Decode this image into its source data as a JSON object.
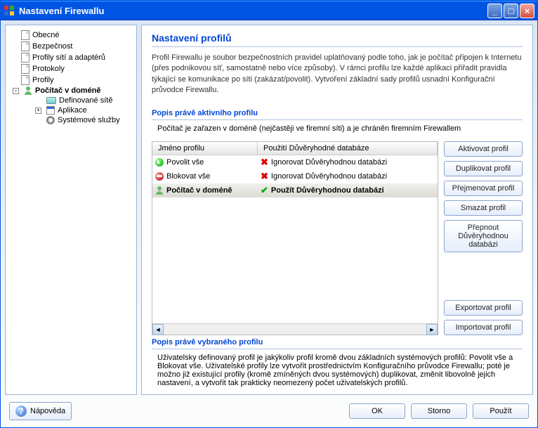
{
  "window": {
    "title": "Nastavení Firewallu"
  },
  "tree": {
    "items": [
      {
        "label": "Obecné",
        "indent": 0,
        "iconType": "page"
      },
      {
        "label": "Bezpečnost",
        "indent": 0,
        "iconType": "page"
      },
      {
        "label": "Profily sítí a adaptérů",
        "indent": 0,
        "iconType": "page"
      },
      {
        "label": "Protokoly",
        "indent": 0,
        "iconType": "page"
      },
      {
        "label": "Profily",
        "indent": 0,
        "iconType": "page"
      },
      {
        "label": "Počítač v doméně",
        "indent": 1,
        "iconType": "user",
        "bold": true,
        "expander": "-"
      },
      {
        "label": "Definované sítě",
        "indent": 2,
        "iconType": "net"
      },
      {
        "label": "Aplikace",
        "indent": 2,
        "iconType": "app",
        "expander": "+"
      },
      {
        "label": "Systémové služby",
        "indent": 2,
        "iconType": "gear"
      }
    ]
  },
  "page": {
    "title": "Nastavení profilů",
    "description": "Profil Firewallu je soubor bezpečnostních pravidel uplatňovaný podle toho, jak je počítač připojen k Internetu (přes podnikovou síť, samostatně nebo více způsoby). V rámci profilu lze každé aplikaci přiřadit pravidla týkající se komunikace po síti (zakázat/povolit). Vytvoření základní sady profilů usnadní Konfigurační průvodce Firewallu.",
    "activeSection": {
      "title": "Popis právě aktivního profilu",
      "description": "Počítač je zařazen v doméně (nejčastěji ve firemní síti) a je chráněn firemním Firewallem"
    },
    "selectedSection": {
      "title": "Popis právě vybraného profilu",
      "description": "Uživatelsky definovaný profil je jakýkoliv profil kromě dvou základních systémových profilů: Povolit vše a Blokovat vše. Uživatelské profily lze vytvořit prostřednictvím Konfiguračního průvodce Firewallu; poté je možno již existující profily (kromě zmíněných dvou systémových) duplikovat, změnit libovolně jejich nastavení, a vytvořit tak prakticky neomezený počet uživatelských profilů."
    }
  },
  "table": {
    "headers": {
      "col1": "Jméno profilu",
      "col2": "Použití Důvěryhodné databáze"
    },
    "rows": [
      {
        "name": "Povolit vše",
        "db": "Ignorovat Důvěryhodnou databázi",
        "icon1": "allow",
        "icon2": "x",
        "selected": false
      },
      {
        "name": "Blokovat vše",
        "db": "Ignorovat Důvěryhodnou databázi",
        "icon1": "block",
        "icon2": "x",
        "selected": false
      },
      {
        "name": "Počítač v doméně",
        "db": "Použít Důvěryhodnou databázi",
        "icon1": "user",
        "icon2": "check",
        "selected": true
      }
    ]
  },
  "buttons": {
    "activate": "Aktivovat profil",
    "duplicate": "Duplikovat profil",
    "rename": "Přejmenovat profil",
    "delete": "Smazat profil",
    "toggleDb": "Přepnout Důvěryhodnou databázi",
    "export": "Exportovat profil",
    "import": "Importovat profil"
  },
  "footer": {
    "help": "Nápověda",
    "ok": "OK",
    "cancel": "Storno",
    "apply": "Použít"
  }
}
